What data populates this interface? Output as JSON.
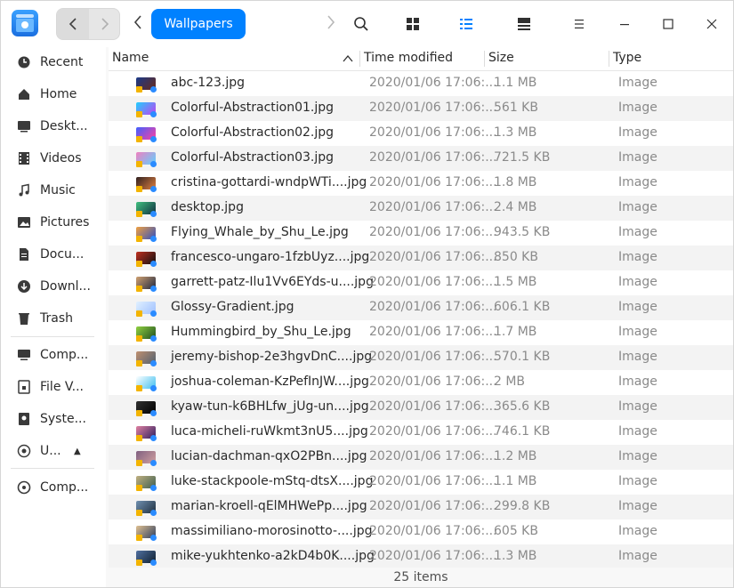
{
  "titlebar": {
    "breadcrumb": "Wallpapers"
  },
  "sidebar": {
    "items": [
      {
        "label": "Recent",
        "icon": "clock-icon"
      },
      {
        "label": "Home",
        "icon": "home-icon"
      },
      {
        "label": "Deskt...",
        "icon": "desktop-icon"
      },
      {
        "label": "Videos",
        "icon": "video-icon"
      },
      {
        "label": "Music",
        "icon": "music-icon"
      },
      {
        "label": "Pictures",
        "icon": "picture-icon"
      },
      {
        "label": "Docu...",
        "icon": "document-icon"
      },
      {
        "label": "Downl...",
        "icon": "download-icon"
      },
      {
        "label": "Trash",
        "icon": "trash-icon"
      }
    ],
    "devices": [
      {
        "label": "Comp...",
        "icon": "computer-icon"
      },
      {
        "label": "File V...",
        "icon": "file-vault-icon"
      },
      {
        "label": "Syste...",
        "icon": "system-disk-icon"
      },
      {
        "label": "U...",
        "icon": "usb-disk-icon"
      }
    ],
    "network": [
      {
        "label": "Comp...",
        "icon": "network-computer-icon"
      }
    ]
  },
  "columns": {
    "name": "Name",
    "time": "Time modified",
    "size": "Size",
    "type": "Type"
  },
  "files": [
    {
      "name": "abc-123.jpg",
      "time": "2020/01/06 17:06:...",
      "size": "1.1 MB",
      "type": "Image",
      "c1": "#6a2a1a",
      "c2": "#1a3a8a"
    },
    {
      "name": "Colorful-Abstraction01.jpg",
      "time": "2020/01/06 17:06:...",
      "size": "561 KB",
      "type": "Image",
      "c1": "#c040f0",
      "c2": "#20d0ff"
    },
    {
      "name": "Colorful-Abstraction02.jpg",
      "time": "2020/01/06 17:06:...",
      "size": "1.3 MB",
      "type": "Image",
      "c1": "#ff40a0",
      "c2": "#4060ff"
    },
    {
      "name": "Colorful-Abstraction03.jpg",
      "time": "2020/01/06 17:06:...",
      "size": "721.5 KB",
      "type": "Image",
      "c1": "#60d0ff",
      "c2": "#f080c0"
    },
    {
      "name": "cristina-gottardi-wndpWTi....jpg",
      "time": "2020/01/06 17:06:...",
      "size": "1.8 MB",
      "type": "Image",
      "c1": "#e08040",
      "c2": "#302020"
    },
    {
      "name": "desktop.jpg",
      "time": "2020/01/06 17:06:...",
      "size": "2.4 MB",
      "type": "Image",
      "c1": "#103040",
      "c2": "#40c080"
    },
    {
      "name": "Flying_Whale_by_Shu_Le.jpg",
      "time": "2020/01/06 17:06:...",
      "size": "943.5 KB",
      "type": "Image",
      "c1": "#3050c0",
      "c2": "#f0a040"
    },
    {
      "name": "francesco-ungaro-1fzbUyz....jpg",
      "time": "2020/01/06 17:06:...",
      "size": "850 KB",
      "type": "Image",
      "c1": "#101010",
      "c2": "#c03020"
    },
    {
      "name": "garrett-patz-Ilu1Vv6EYds-u....jpg",
      "time": "2020/01/06 17:06:...",
      "size": "1.5 MB",
      "type": "Image",
      "c1": "#202840",
      "c2": "#d0a070"
    },
    {
      "name": "Glossy-Gradient.jpg",
      "time": "2020/01/06 17:06:...",
      "size": "606.1 KB",
      "type": "Image",
      "c1": "#a0c0ff",
      "c2": "#e0f0ff"
    },
    {
      "name": "Hummingbird_by_Shu_Le.jpg",
      "time": "2020/01/06 17:06:...",
      "size": "1.7 MB",
      "type": "Image",
      "c1": "#205020",
      "c2": "#90d040"
    },
    {
      "name": "jeremy-bishop-2e3hgvDnC....jpg",
      "time": "2020/01/06 17:06:...",
      "size": "570.1 KB",
      "type": "Image",
      "c1": "#506070",
      "c2": "#c09070"
    },
    {
      "name": "joshua-coleman-KzPefInJW....jpg",
      "time": "2020/01/06 17:06:...",
      "size": "2 MB",
      "type": "Image",
      "c1": "#40c0f0",
      "c2": "#ffffff"
    },
    {
      "name": "kyaw-tun-k6BHLfw_jUg-un....jpg",
      "time": "2020/01/06 17:06:...",
      "size": "365.6 KB",
      "type": "Image",
      "c1": "#000000",
      "c2": "#303030"
    },
    {
      "name": "luca-micheli-ruWkmt3nU5....jpg",
      "time": "2020/01/06 17:06:...",
      "size": "746.1 KB",
      "type": "Image",
      "c1": "#302060",
      "c2": "#e080a0"
    },
    {
      "name": "lucian-dachman-qxO2PBn....jpg",
      "time": "2020/01/06 17:06:...",
      "size": "1.2 MB",
      "type": "Image",
      "c1": "#d0a0a0",
      "c2": "#806080"
    },
    {
      "name": "luke-stackpoole-mStq-dtsX....jpg",
      "time": "2020/01/06 17:06:...",
      "size": "1.1 MB",
      "type": "Image",
      "c1": "#406050",
      "c2": "#c0b080"
    },
    {
      "name": "marian-kroell-qElMHWePp....jpg",
      "time": "2020/01/06 17:06:...",
      "size": "299.8 KB",
      "type": "Image",
      "c1": "#203040",
      "c2": "#7090b0"
    },
    {
      "name": "massimiliano-morosinotto-....jpg",
      "time": "2020/01/06 17:06:...",
      "size": "605 KB",
      "type": "Image",
      "c1": "#304060",
      "c2": "#e0c090"
    },
    {
      "name": "mike-yukhtenko-a2kD4b0K....jpg",
      "time": "2020/01/06 17:06:...",
      "size": "1.3 MB",
      "type": "Image",
      "c1": "#102030",
      "c2": "#5070a0"
    }
  ],
  "status": {
    "count": "25 items"
  }
}
